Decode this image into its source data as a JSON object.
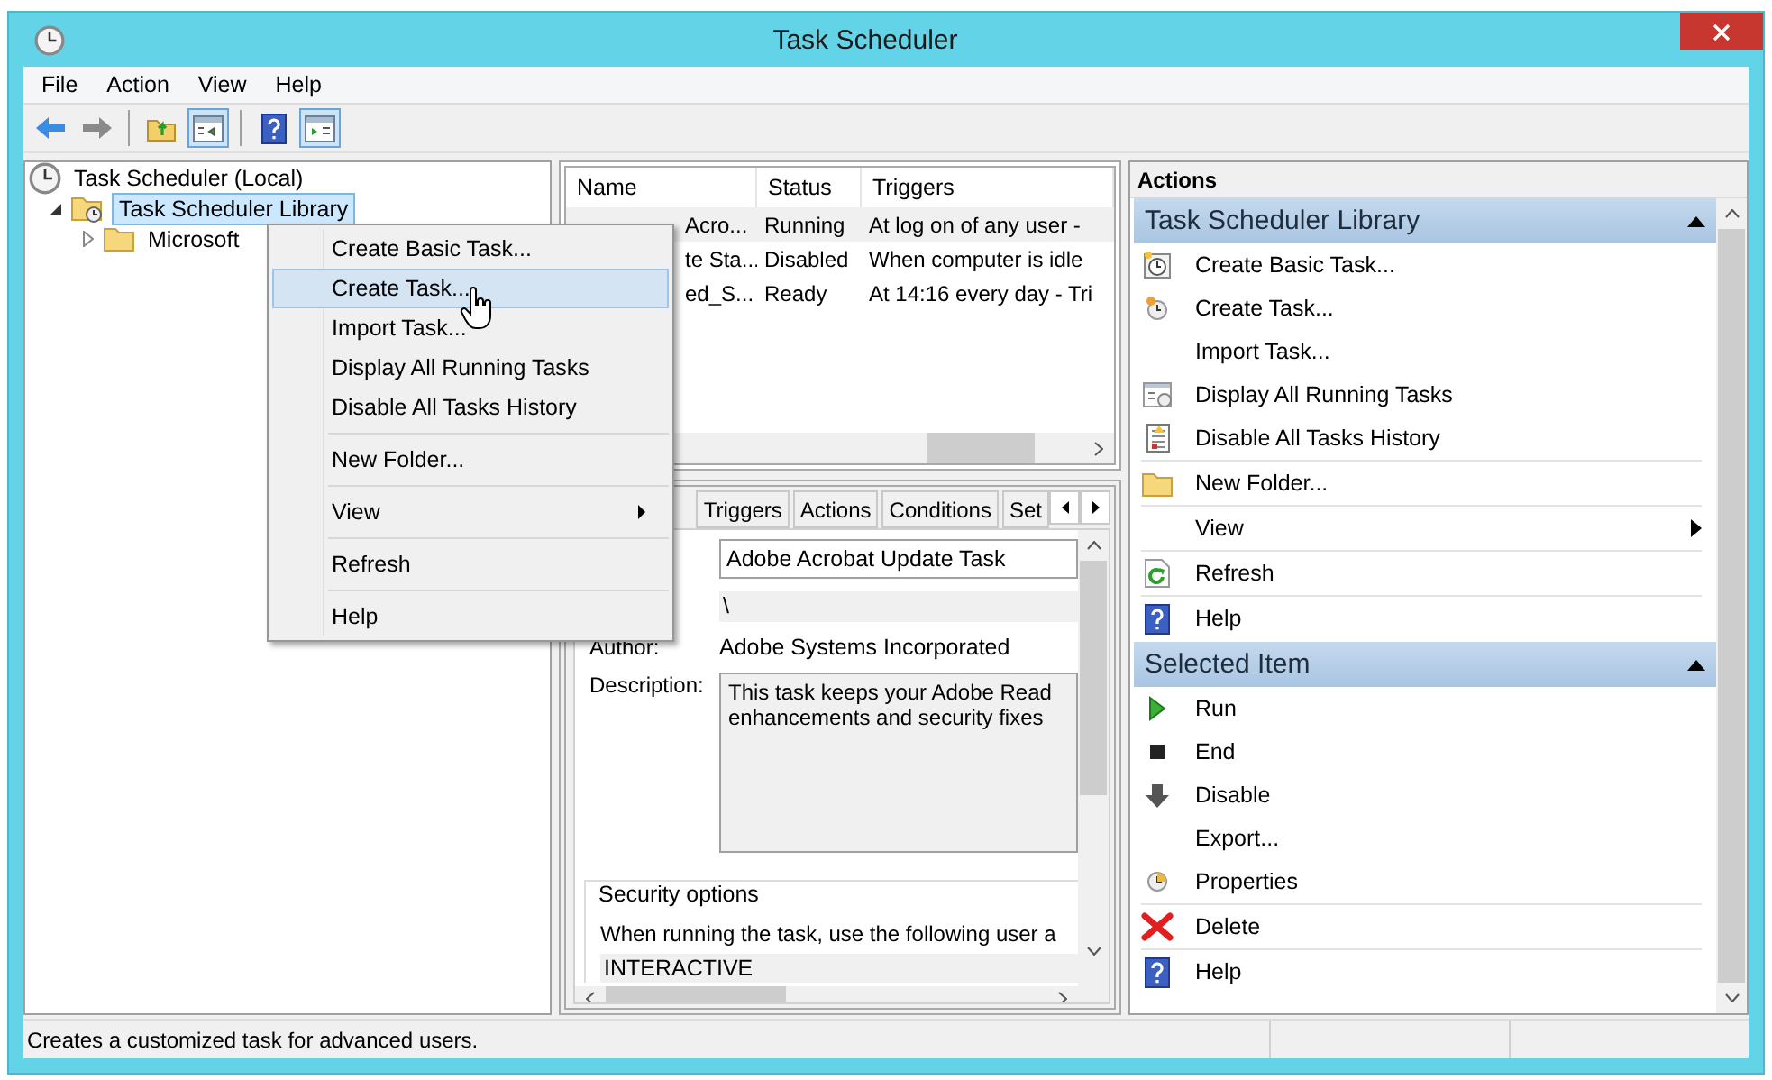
{
  "window": {
    "title": "Task Scheduler"
  },
  "menu_bar": [
    "File",
    "Action",
    "View",
    "Help"
  ],
  "toolbar": [
    {
      "kind": "back",
      "pressed": false
    },
    {
      "kind": "forward",
      "pressed": false
    },
    {
      "kind": "separator"
    },
    {
      "kind": "up-folder",
      "pressed": false
    },
    {
      "kind": "tree-pane",
      "pressed": true
    },
    {
      "kind": "separator"
    },
    {
      "kind": "help",
      "pressed": false
    },
    {
      "kind": "action-pane",
      "pressed": true
    }
  ],
  "tree": [
    {
      "label": "Task Scheduler (Local)",
      "kind": "root",
      "selected": false,
      "children": [
        {
          "label": "Task Scheduler Library",
          "kind": "library",
          "expanded": true,
          "selected": true,
          "children": [
            {
              "label": "Microsoft",
              "kind": "folder",
              "expanded": false,
              "selected": false
            }
          ]
        }
      ]
    }
  ],
  "context_menu": [
    {
      "kind": "item",
      "label": "Create Basic Task...",
      "selected": false
    },
    {
      "kind": "item",
      "label": "Create Task...",
      "selected": true
    },
    {
      "kind": "item",
      "label": "Import Task...",
      "selected": false
    },
    {
      "kind": "item",
      "label": "Display All Running Tasks",
      "selected": false
    },
    {
      "kind": "item",
      "label": "Disable All Tasks History",
      "selected": false
    },
    {
      "kind": "separator"
    },
    {
      "kind": "item",
      "label": "New Folder...",
      "selected": false
    },
    {
      "kind": "separator"
    },
    {
      "kind": "submenu",
      "label": "View",
      "selected": false
    },
    {
      "kind": "separator"
    },
    {
      "kind": "item",
      "label": "Refresh",
      "selected": false
    },
    {
      "kind": "separator"
    },
    {
      "kind": "item",
      "label": "Help",
      "selected": false
    }
  ],
  "task_list": {
    "columns": [
      "Name",
      "Status",
      "Triggers"
    ],
    "rows": [
      {
        "name": "Acro...",
        "status": "Running",
        "triggers": "At log on of any user -",
        "selected": true
      },
      {
        "name": "te Sta...",
        "status": "Disabled",
        "triggers": "When computer is idle",
        "selected": false
      },
      {
        "name": "ed_S...",
        "status": "Ready",
        "triggers": "At 14:16 every day - Tri",
        "selected": false
      }
    ]
  },
  "detail": {
    "tabs": [
      "Triggers",
      "Actions",
      "Conditions",
      "Set"
    ],
    "name_value": "Adobe Acrobat Update Task",
    "location_value": "\\",
    "author_label": "Author:",
    "author_value": "Adobe Systems Incorporated",
    "description_label": "Description:",
    "description_lines": [
      "This task keeps your Adobe Read",
      "enhancements and security fixes"
    ],
    "security_legend": "Security options",
    "security_text": "When running the task, use the following user a",
    "security_account": "INTERACTIVE"
  },
  "actions_pane": {
    "title": "Actions",
    "sections": [
      {
        "title": "Task Scheduler Library",
        "expanded": true,
        "groups": [
          [
            {
              "label": "Create Basic Task...",
              "kind": "basic-task"
            },
            {
              "label": "Create Task...",
              "kind": "task"
            },
            {
              "label": "Import Task...",
              "kind": "plain"
            },
            {
              "label": "Display All Running Tasks",
              "kind": "running"
            },
            {
              "label": "Disable All Tasks History",
              "kind": "history"
            }
          ],
          [
            {
              "label": "New Folder...",
              "kind": "folder"
            }
          ],
          [
            {
              "label": "View",
              "kind": "plain",
              "submenu": true
            }
          ],
          [
            {
              "label": "Refresh",
              "kind": "refresh"
            }
          ],
          [
            {
              "label": "Help",
              "kind": "help"
            }
          ]
        ]
      },
      {
        "title": "Selected Item",
        "expanded": true,
        "groups": [
          [
            {
              "label": "Run",
              "kind": "run"
            },
            {
              "label": "End",
              "kind": "end"
            },
            {
              "label": "Disable",
              "kind": "disable"
            },
            {
              "label": "Export...",
              "kind": "plain"
            },
            {
              "label": "Properties",
              "kind": "properties"
            }
          ],
          [
            {
              "label": "Delete",
              "kind": "delete"
            }
          ],
          [
            {
              "label": "Help",
              "kind": "help"
            }
          ]
        ]
      }
    ]
  },
  "status_bar": {
    "text": "Creates a customized task for advanced users."
  }
}
